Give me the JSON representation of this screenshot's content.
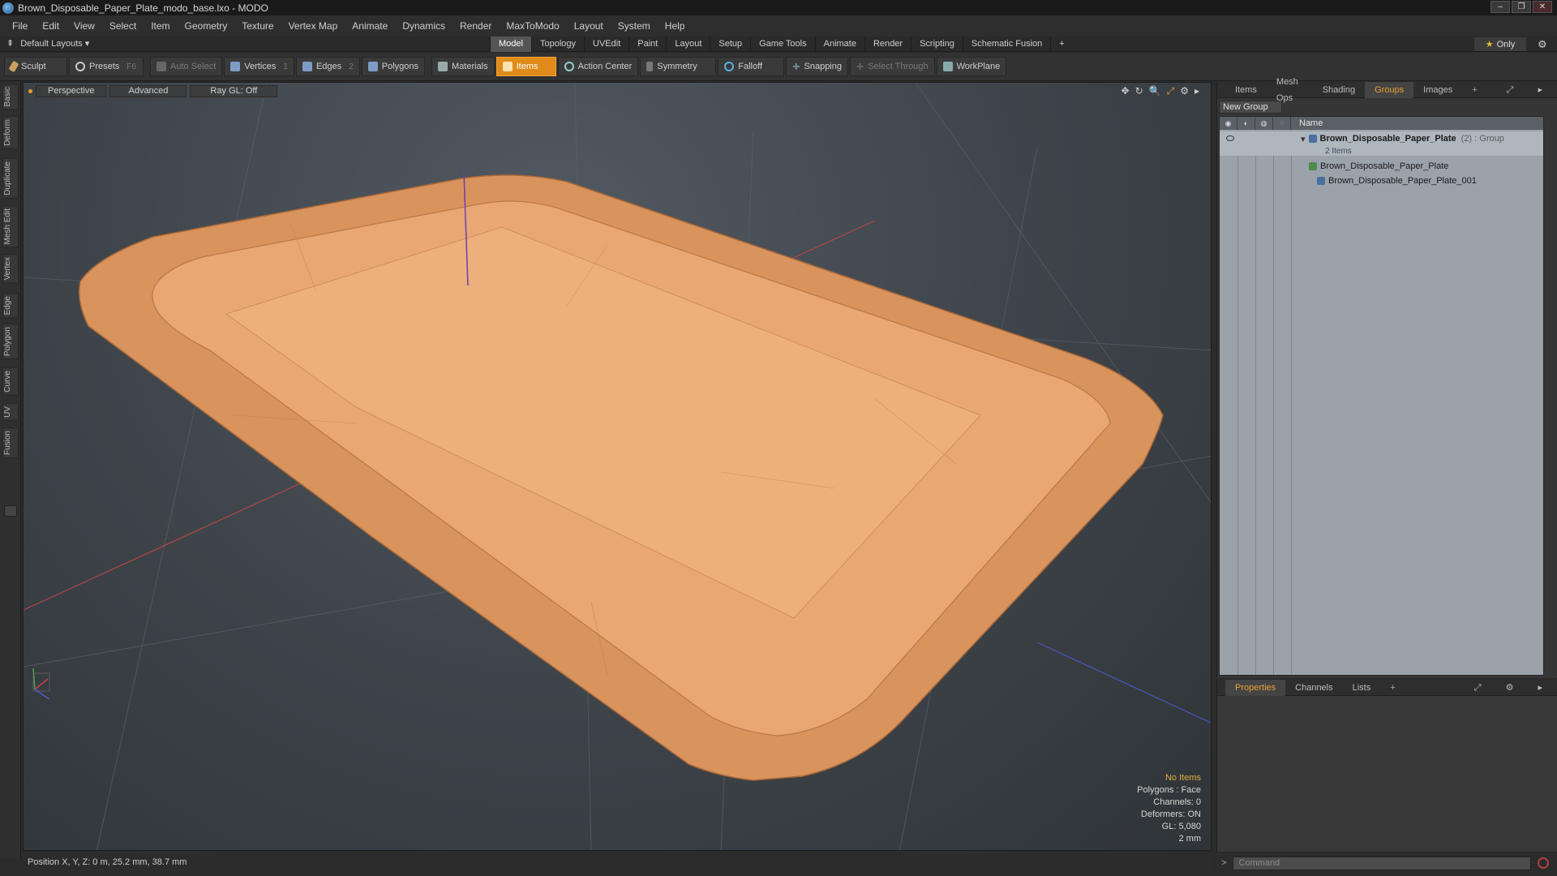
{
  "window": {
    "title": "Brown_Disposable_Paper_Plate_modo_base.lxo - MODO",
    "controls": [
      "–",
      "❐",
      "✕"
    ]
  },
  "menu": [
    "File",
    "Edit",
    "View",
    "Select",
    "Item",
    "Geometry",
    "Texture",
    "Vertex Map",
    "Animate",
    "Dynamics",
    "Render",
    "MaxToModo",
    "Layout",
    "System",
    "Help"
  ],
  "layoutbar": {
    "layouts_label": "Default Layouts ▾",
    "tabs": [
      "Model",
      "Topology",
      "UVEdit",
      "Paint",
      "Layout",
      "Setup",
      "Game Tools",
      "Animate",
      "Render",
      "Scripting",
      "Schematic Fusion",
      "+"
    ],
    "active_tab": "Model",
    "only_star": "★",
    "only_label": "Only",
    "gear": "⚙"
  },
  "toolbar": {
    "sculpt": "Sculpt",
    "presets": "Presets",
    "presets_key": "F6",
    "auto_select": "Auto Select",
    "vertices": "Vertices",
    "vertices_key": "1",
    "edges": "Edges",
    "edges_key": "2",
    "polygons": "Polygons",
    "materials": "Materials",
    "items": "Items",
    "action_center": "Action Center",
    "symmetry": "Symmetry",
    "falloff": "Falloff",
    "snapping": "Snapping",
    "select_through": "Select Through",
    "workplane": "WorkPlane"
  },
  "left_tabs": [
    "Basic",
    "Deform",
    "Duplicate",
    "Mesh Edit",
    "Vertex",
    "Edge",
    "Polygon",
    "Curve",
    "UV",
    "Fusion"
  ],
  "viewport": {
    "view_mode": "Perspective",
    "shading": "Advanced",
    "raygl": "Ray GL: Off",
    "icons": [
      "✥",
      "↻",
      "🔍",
      "⤢",
      "⚙",
      "▸"
    ],
    "info": {
      "no_items": "No Items",
      "polygons": "Polygons : Face",
      "channels": "Channels: 0",
      "deformers": "Deformers: ON",
      "gl": "GL: 5,080",
      "scale": "2 mm"
    }
  },
  "statusbar": {
    "position": "Position X, Y, Z:  0 m, 25.2 mm, 38.7 mm"
  },
  "groups_panel": {
    "tabs": [
      "Items",
      "Mesh Ops",
      "Shading",
      "Groups",
      "Images",
      "+"
    ],
    "active_tab": "Groups",
    "new_group": "New Group",
    "column_name": "Name",
    "rows": {
      "group_name": "Brown_Disposable_Paper_Plate",
      "group_meta": "(2) : Group",
      "group_sub": "2 Items",
      "item1": "Brown_Disposable_Paper_Plate",
      "item2": "Brown_Disposable_Paper_Plate_001"
    }
  },
  "props_panel": {
    "tabs": [
      "Properties",
      "Channels",
      "Lists",
      "+"
    ],
    "active_tab": "Properties"
  },
  "command": {
    "prompt": ">",
    "placeholder": "Command"
  },
  "colors": {
    "accent": "#e08b1a",
    "plate": "#e0a06a",
    "viewport_bg": "#3d4348"
  }
}
